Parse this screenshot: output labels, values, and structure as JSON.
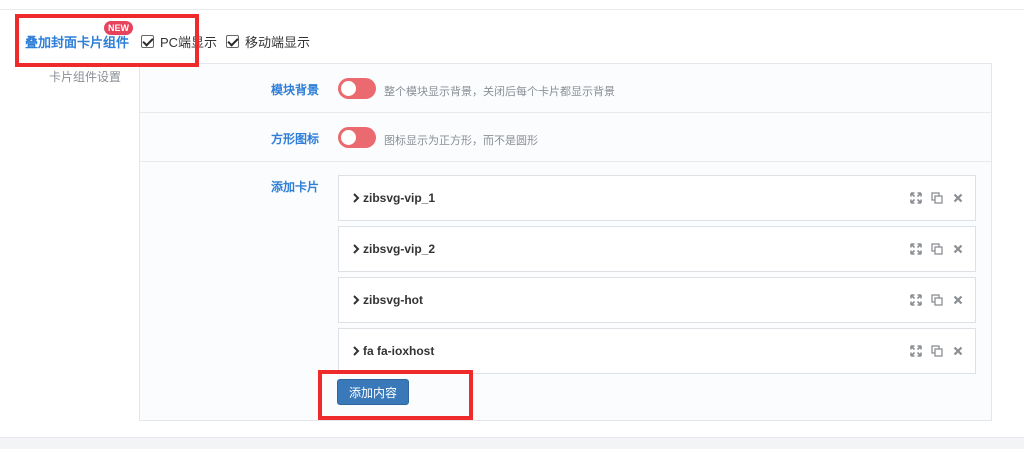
{
  "header": {
    "title": "叠加封面卡片组件",
    "badge": "NEW",
    "options": [
      {
        "label": "PC端显示",
        "checked": true
      },
      {
        "label": "移动端显示",
        "checked": true
      }
    ]
  },
  "section": {
    "label": "卡片组件设置"
  },
  "settings": {
    "module_bg": {
      "label": "模块背景",
      "description": "整个模块显示背景，关闭后每个卡片都显示背景",
      "enabled": false
    },
    "square_icon": {
      "label": "方形图标",
      "description": "图标显示为正方形，而不是圆形",
      "enabled": false
    }
  },
  "cards": {
    "label": "添加卡片",
    "items": [
      {
        "title": "zibsvg-vip_1"
      },
      {
        "title": "zibsvg-vip_2"
      },
      {
        "title": "zibsvg-hot"
      },
      {
        "title": "fa fa-ioxhost"
      }
    ],
    "add_button": "添加内容"
  },
  "colors": {
    "accent_label": "#2f7fd8",
    "toggle_off": "#ea6a70",
    "badge": "#e8435c",
    "button": "#3a79b9",
    "highlight": "#ee2a2a"
  },
  "icons": {
    "card_actions": [
      "expand-icon",
      "copy-icon",
      "close-icon"
    ],
    "card_toggle": "chevron-right-icon"
  }
}
